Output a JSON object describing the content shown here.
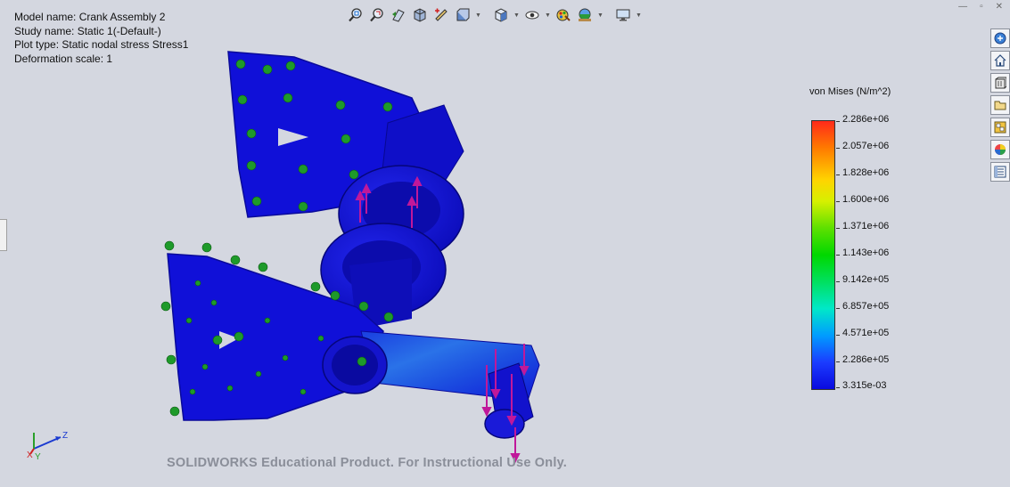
{
  "info": {
    "model_name": "Model name: Crank Assembly 2",
    "study_name": "Study name: Static 1(-Default-)",
    "plot_type": "Plot type: Static nodal stress Stress1",
    "deformation_scale": "Deformation scale: 1"
  },
  "toolbar": {
    "icons": [
      "zoom-to-fit-icon",
      "zoom-to-area-icon",
      "previous-view-icon",
      "section-view-icon",
      "dynamic-annotation-icon",
      "display-style-icon",
      "view-orientation-icon",
      "hide-show-icon",
      "edit-appearance-icon",
      "apply-scene-icon",
      "view-settings-icon"
    ]
  },
  "taskpane": {
    "icons": [
      "solidworks-resources-icon",
      "home-icon",
      "design-library-icon",
      "file-explorer-icon",
      "view-palette-icon",
      "appearances-icon",
      "custom-properties-icon"
    ]
  },
  "legend": {
    "title": "von Mises (N/m^2)",
    "labels": [
      "2.286e+06",
      "2.057e+06",
      "1.828e+06",
      "1.600e+06",
      "1.371e+06",
      "1.143e+06",
      "9.142e+05",
      "6.857e+05",
      "4.571e+05",
      "2.286e+05",
      "3.315e-03"
    ],
    "colors": {
      "max": "#ff2a1a",
      "high": "#ffd400",
      "mid": "#00d800",
      "low": "#009cff",
      "min": "#0a0adf"
    }
  },
  "model": {
    "body_color": "#1010d8",
    "fixture_color": "#1e9a2a",
    "load_color": "#c0189a"
  },
  "triad": {
    "z": "Z",
    "x": "X",
    "y": "Y"
  },
  "watermark": "SOLIDWORKS Educational Product. For Instructional Use Only."
}
